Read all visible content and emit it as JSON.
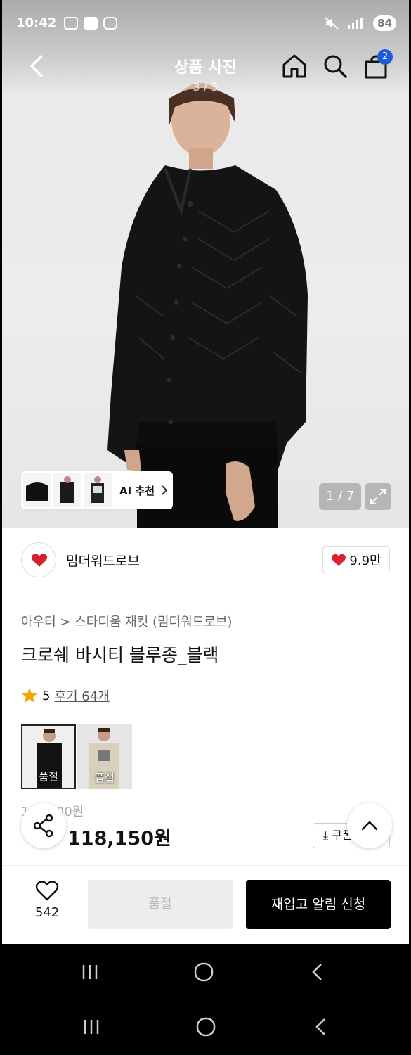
{
  "status_bar": {
    "time": "10:42",
    "battery": "84"
  },
  "header": {
    "title": "상품 사진",
    "subtitle": "3 / 3",
    "cart_count": "2"
  },
  "gallery": {
    "ai_label": "AI 추천",
    "page_indicator": "1 / 7"
  },
  "brand": {
    "name": "밈더워드로브",
    "likes": "9.9만"
  },
  "product": {
    "breadcrumb": "아우터 > 스타디움 재킷 (밈더워드로브)",
    "title": "크로쉐 바시티 블루종_블랙",
    "rating": "5",
    "reviews": "후기 64개",
    "options": [
      {
        "label": "품절",
        "color": "#121212"
      },
      {
        "label": "품절",
        "color": "#d8cfbc"
      }
    ],
    "original_price": "1_ _,_00원",
    "sale_price": "118,150원",
    "coupon": "쿠폰"
  },
  "bottom_bar": {
    "wish_count": "542",
    "soldout_label": "품절",
    "restock_label": "재입고 알림 신청"
  }
}
